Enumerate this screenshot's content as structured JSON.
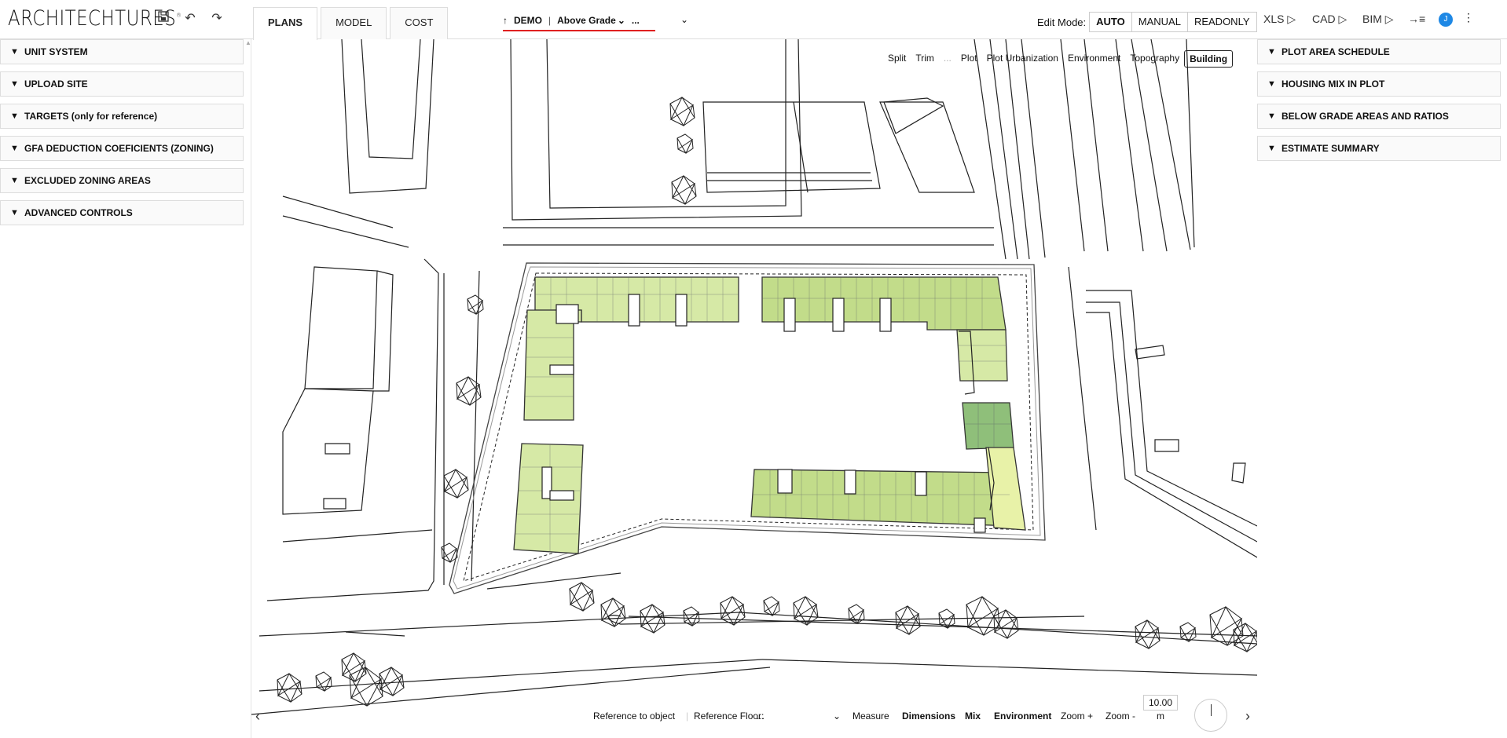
{
  "app": {
    "logo": "ARCHITECHTURES",
    "logo_mark": "®"
  },
  "toolbar": {
    "save_icon": "save-icon",
    "undo_icon": "undo-icon",
    "redo_icon": "redo-icon"
  },
  "tabs": [
    {
      "label": "PLANS",
      "active": true
    },
    {
      "label": "MODEL",
      "active": false
    },
    {
      "label": "COST",
      "active": false
    }
  ],
  "project": {
    "name": "DEMO",
    "separator": "|",
    "level": "Above Grade",
    "more": "..."
  },
  "edit_mode": {
    "label": "Edit Mode:",
    "options": [
      "AUTO",
      "MANUAL",
      "READONLY"
    ],
    "active": "AUTO"
  },
  "exports": [
    "XLS ▷",
    "CAD ▷",
    "BIM ▷"
  ],
  "user": {
    "initial": "J"
  },
  "left_panel": [
    "UNIT SYSTEM",
    "UPLOAD SITE",
    "TARGETS (only for reference)",
    "GFA DEDUCTION COEFICIENTS (ZONING)",
    "EXCLUDED ZONING AREAS",
    "ADVANCED CONTROLS"
  ],
  "right_panel": [
    "PLOT AREA SCHEDULE",
    "HOUSING MIX IN PLOT",
    "BELOW GRADE AREAS AND RATIOS",
    "ESTIMATE SUMMARY"
  ],
  "view_tabs": {
    "items": [
      "Split",
      "Trim",
      "...",
      "Plot",
      "Plot Urbanization",
      "Environment",
      "Topography",
      "Building"
    ],
    "active": "Building"
  },
  "bottom": {
    "reference_object": "Reference to object",
    "reference_floor_label": "Reference Floor:",
    "reference_floor_value": "...",
    "measure": "Measure",
    "dimensions": "Dimensions",
    "mix": "Mix",
    "environment": "Environment",
    "zoom_in": "Zoom +",
    "zoom_out": "Zoom -",
    "scale_value": "10.00",
    "scale_unit": "m"
  },
  "colors": {
    "accent_red": "#e02020",
    "avatar_blue": "#1e88e5",
    "unit_green_light": "#d6e9a6",
    "unit_green_mid": "#c2dc8a",
    "unit_green_dark": "#8fbf7a",
    "unit_yellow": "#e8f2a8"
  }
}
